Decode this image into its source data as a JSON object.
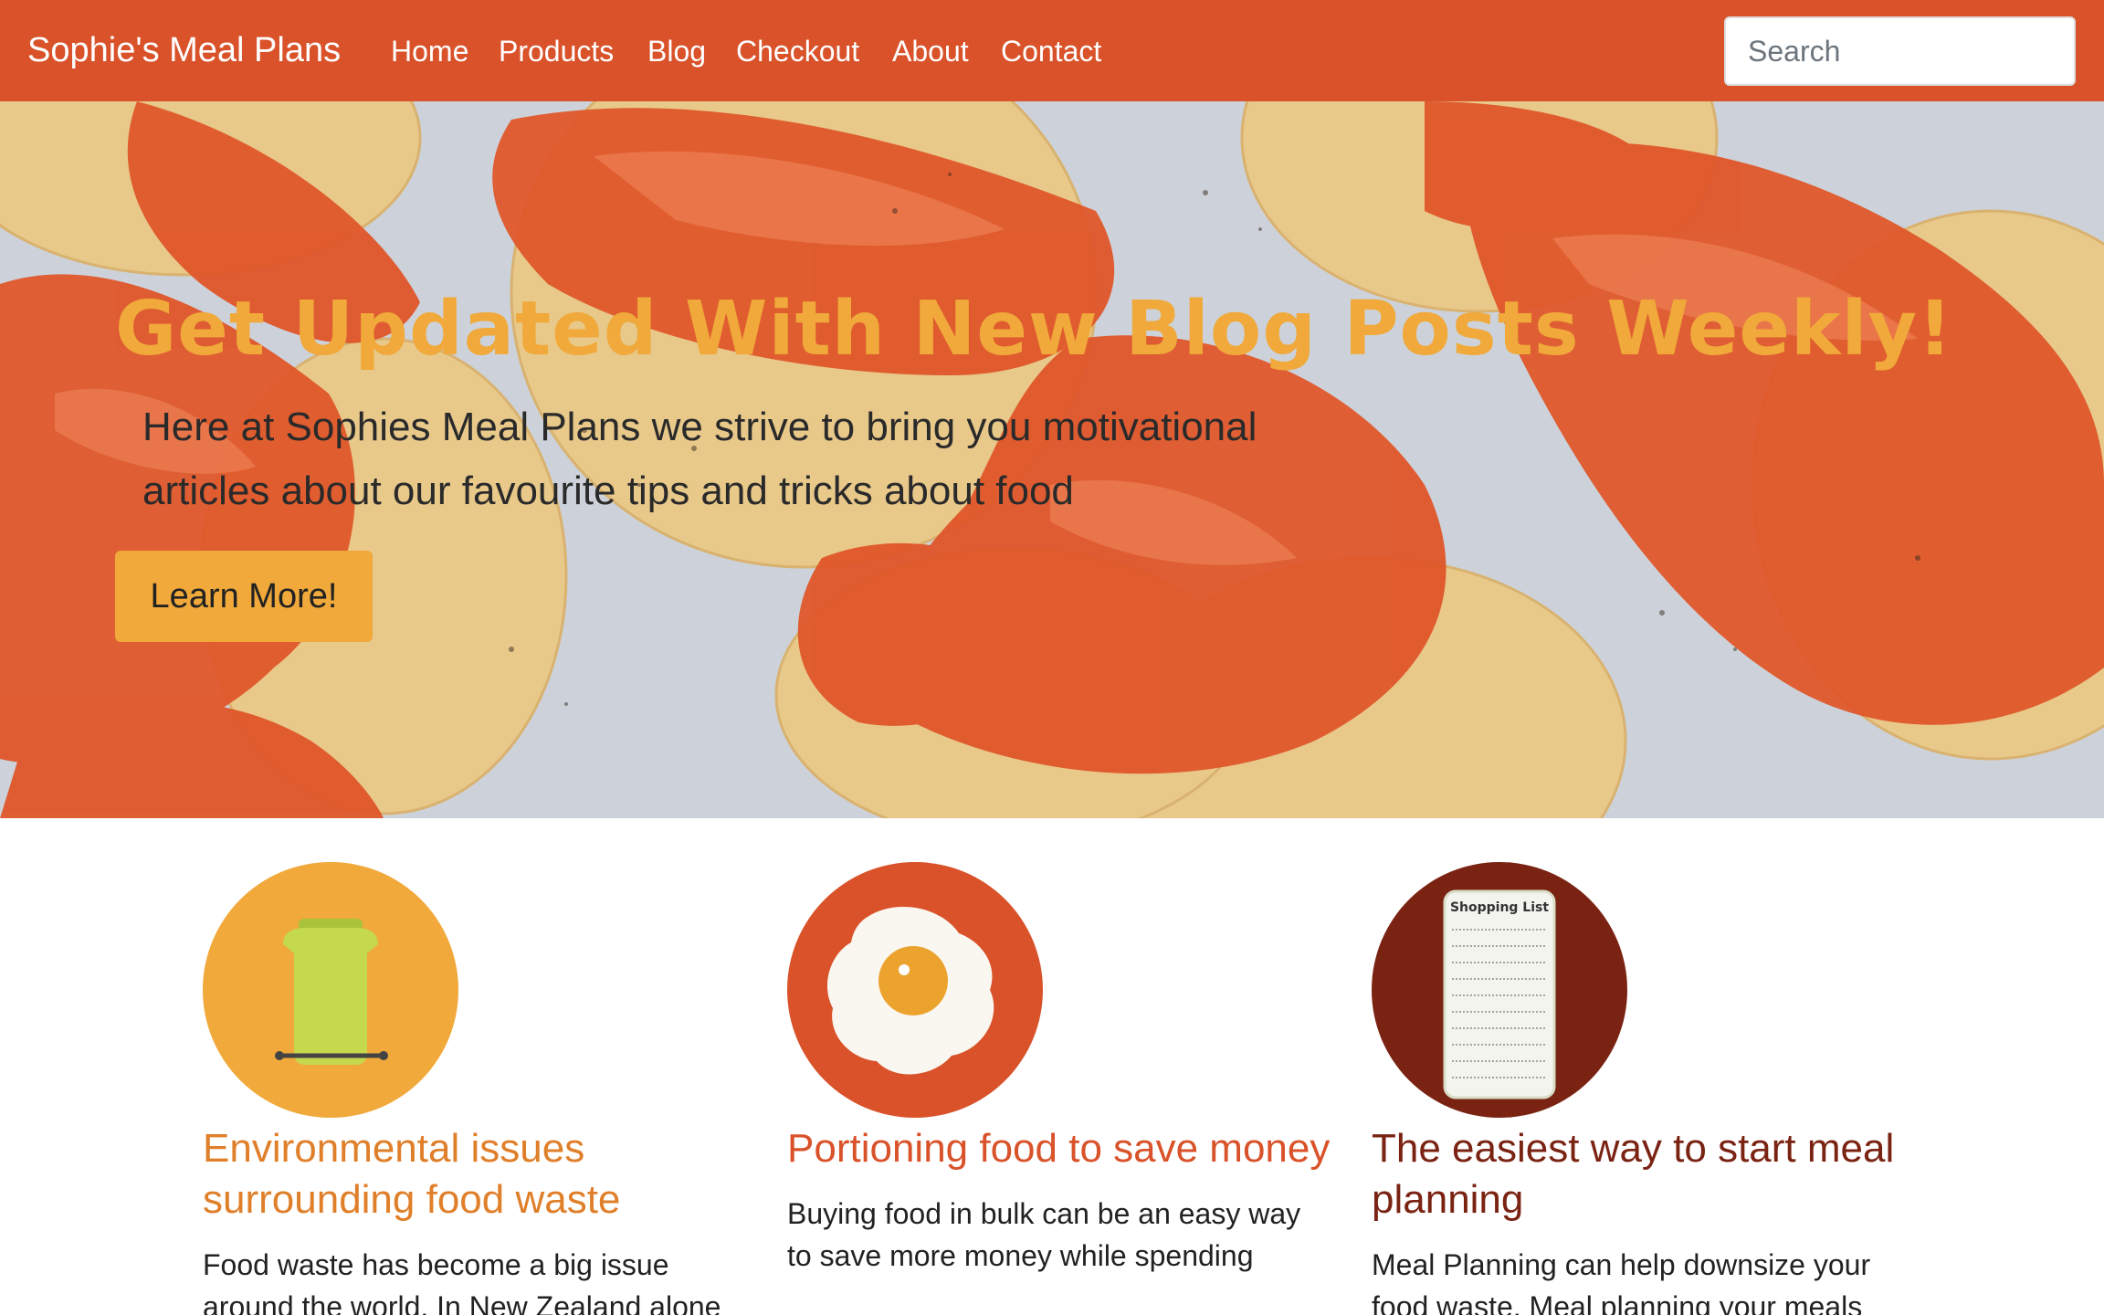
{
  "nav": {
    "brand": "Sophie's Meal Plans",
    "items": [
      {
        "label": "Home"
      },
      {
        "label": "Products"
      },
      {
        "label": "Blog"
      },
      {
        "label": "Checkout"
      },
      {
        "label": "About"
      },
      {
        "label": "Contact"
      }
    ],
    "search_placeholder": "Search"
  },
  "hero": {
    "title": "Get Updated With New Blog Posts Weekly!",
    "text": "Here at Sophies Meal Plans we strive to bring you motivational articles about our favourite tips and tricks about food",
    "button_label": "Learn More!"
  },
  "features": [
    {
      "icon": "jar-icon",
      "title": "Environmental issues surrounding food waste",
      "text": "Food waste has become a big issue around the world. In New Zealand alone",
      "title_color": "#e07f2a",
      "circle_color": "#f0a93a"
    },
    {
      "icon": "egg-icon",
      "title": "Portioning food to save money",
      "text": "Buying food in bulk can be an easy way to save more money while spending",
      "title_color": "#d9522a",
      "circle_color": "#d9522a"
    },
    {
      "icon": "shopping-list-icon",
      "icon_label": "Shopping List",
      "title": "The easiest way to start meal planning",
      "text": "Meal Planning can help downsize your food waste. Meal planning your meals",
      "title_color": "#7a2312",
      "circle_color": "#7a2312"
    }
  ],
  "colors": {
    "navbar": "#d9522a",
    "accent": "#f0a93a"
  }
}
